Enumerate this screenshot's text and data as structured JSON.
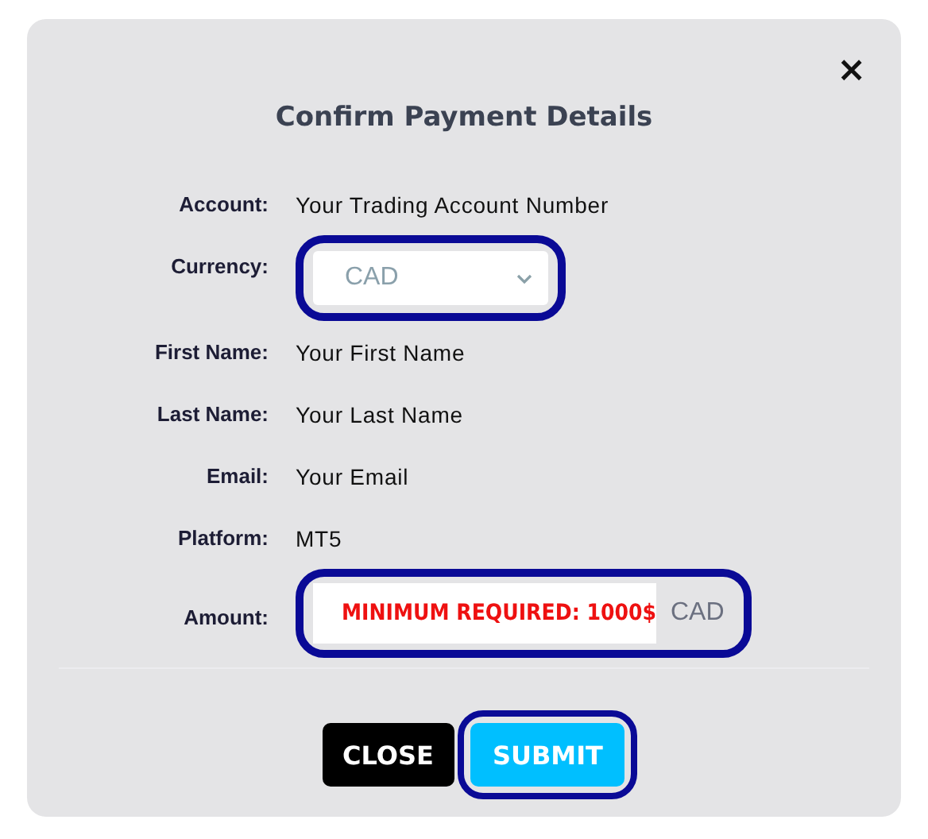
{
  "dialog": {
    "title": "Confirm Payment Details",
    "close_icon": "×"
  },
  "fields": [
    {
      "kind": "text",
      "label": "Account:",
      "value": "Your Trading Account Number"
    },
    {
      "kind": "select",
      "label": "Currency:",
      "value": "CAD",
      "highlighted": true
    },
    {
      "kind": "text",
      "label": "First Name:",
      "value": "Your First Name"
    },
    {
      "kind": "text",
      "label": "Last Name:",
      "value": "Your Last Name"
    },
    {
      "kind": "text",
      "label": "Email:",
      "value": "Your Email"
    },
    {
      "kind": "text",
      "label": "Platform:",
      "value": "MT5"
    },
    {
      "kind": "amount",
      "label": "Amount:",
      "placeholder": "MINIMUM REQUIRED: 1000$",
      "suffix": "CAD",
      "highlighted": true
    }
  ],
  "buttons": [
    {
      "kind": "close",
      "label": "CLOSE",
      "highlighted": false
    },
    {
      "kind": "submit",
      "label": "SUBMIT",
      "highlighted": true
    }
  ]
}
